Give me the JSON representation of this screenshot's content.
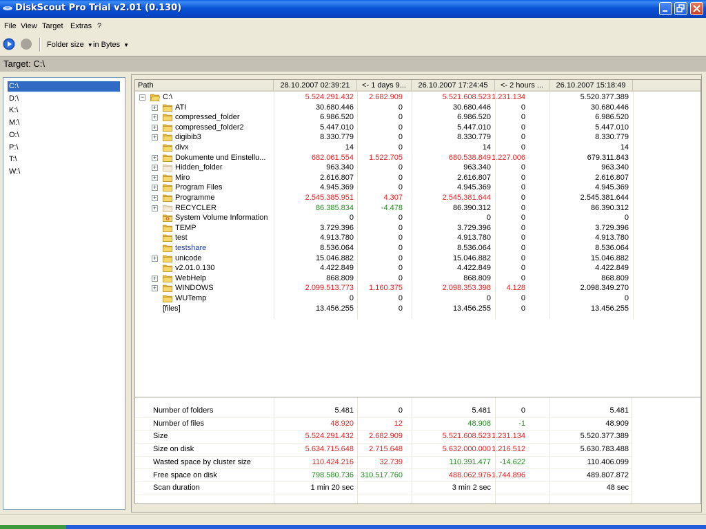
{
  "window": {
    "title": "DiskScout Pro Trial v2.01 (0.130)"
  },
  "menu": [
    "File",
    "View",
    "Target",
    "Extras",
    "?"
  ],
  "toolbar": {
    "mode": "Folder size",
    "unit": "in Bytes"
  },
  "target": {
    "label": "Target: C:\\"
  },
  "drives": [
    "C:\\",
    "D:\\",
    "K:\\",
    "M:\\",
    "O:\\",
    "P:\\",
    "T:\\",
    "W:\\"
  ],
  "selected_drive": "C:\\",
  "columns": [
    "Path",
    "28.10.2007 02:39:21",
    "<- 1 days 9...",
    "26.10.2007 17:24:45",
    "<- 2 hours ...",
    "26.10.2007 15:18:49"
  ],
  "colors": {
    "increase": "#e02020",
    "decrease": "#1e8a1e",
    "shared": "#1d3ba8",
    "selection": "#316ac5"
  },
  "tree": [
    {
      "name": "C:\\",
      "level": 0,
      "expander": "minus",
      "icon": "folder-open-icon",
      "color": "red",
      "values": [
        "5.524.291.432",
        "2.682.909",
        "5.521.608.523",
        "1.231.134",
        "5.520.377.389"
      ]
    },
    {
      "name": "ATI",
      "level": 1,
      "expander": "plus",
      "icon": "folder-icon",
      "color": "",
      "values": [
        "30.680.446",
        "0",
        "30.680.446",
        "0",
        "30.680.446"
      ]
    },
    {
      "name": "compressed_folder",
      "level": 1,
      "expander": "plus",
      "icon": "folder-icon",
      "color": "",
      "values": [
        "6.986.520",
        "0",
        "6.986.520",
        "0",
        "6.986.520"
      ]
    },
    {
      "name": "compressed_folder2",
      "level": 1,
      "expander": "plus",
      "icon": "folder-icon",
      "color": "",
      "values": [
        "5.447.010",
        "0",
        "5.447.010",
        "0",
        "5.447.010"
      ]
    },
    {
      "name": "digibib3",
      "level": 1,
      "expander": "plus",
      "icon": "folder-icon",
      "color": "",
      "values": [
        "8.330.779",
        "0",
        "8.330.779",
        "0",
        "8.330.779"
      ]
    },
    {
      "name": "divx",
      "level": 1,
      "expander": "",
      "icon": "folder-icon",
      "color": "",
      "values": [
        "14",
        "0",
        "14",
        "0",
        "14"
      ]
    },
    {
      "name": "Dokumente und Einstellu...",
      "level": 1,
      "expander": "plus",
      "icon": "folder-icon",
      "color": "red",
      "values": [
        "682.061.554",
        "1.522.705",
        "680.538.849",
        "1.227.006",
        "679.311.843"
      ]
    },
    {
      "name": "Hidden_folder",
      "level": 1,
      "expander": "plus",
      "icon": "folder-hidden-icon",
      "color": "",
      "values": [
        "963.340",
        "0",
        "963.340",
        "0",
        "963.340"
      ]
    },
    {
      "name": "Miro",
      "level": 1,
      "expander": "plus",
      "icon": "folder-icon",
      "color": "",
      "values": [
        "2.616.807",
        "0",
        "2.616.807",
        "0",
        "2.616.807"
      ]
    },
    {
      "name": "Program Files",
      "level": 1,
      "expander": "plus",
      "icon": "folder-icon",
      "color": "",
      "values": [
        "4.945.369",
        "0",
        "4.945.369",
        "0",
        "4.945.369"
      ]
    },
    {
      "name": "Programme",
      "level": 1,
      "expander": "plus",
      "icon": "folder-icon",
      "color": "red",
      "values": [
        "2.545.385.951",
        "4.307",
        "2.545.381.644",
        "0",
        "2.545.381.644"
      ]
    },
    {
      "name": "RECYCLER",
      "level": 1,
      "expander": "plus",
      "icon": "folder-hidden-icon",
      "color": "green",
      "values": [
        "86.385.834",
        "-4.478",
        "86.390.312",
        "0",
        "86.390.312"
      ]
    },
    {
      "name": "System Volume Information",
      "level": 1,
      "expander": "",
      "icon": "folder-locked-icon",
      "color": "",
      "values": [
        "0",
        "0",
        "0",
        "0",
        "0"
      ]
    },
    {
      "name": "TEMP",
      "level": 1,
      "expander": "",
      "icon": "folder-icon",
      "color": "",
      "values": [
        "3.729.396",
        "0",
        "3.729.396",
        "0",
        "3.729.396"
      ]
    },
    {
      "name": "test",
      "level": 1,
      "expander": "",
      "icon": "folder-icon",
      "color": "",
      "values": [
        "4.913.780",
        "0",
        "4.913.780",
        "0",
        "4.913.780"
      ]
    },
    {
      "name": "testshare",
      "level": 1,
      "expander": "",
      "icon": "folder-icon",
      "color": "blue",
      "values": [
        "8.536.064",
        "0",
        "8.536.064",
        "0",
        "8.536.064"
      ]
    },
    {
      "name": "unicode",
      "level": 1,
      "expander": "plus",
      "icon": "folder-icon",
      "color": "",
      "values": [
        "15.046.882",
        "0",
        "15.046.882",
        "0",
        "15.046.882"
      ]
    },
    {
      "name": "v2.01.0.130",
      "level": 1,
      "expander": "",
      "icon": "folder-icon",
      "color": "",
      "values": [
        "4.422.849",
        "0",
        "4.422.849",
        "0",
        "4.422.849"
      ]
    },
    {
      "name": "WebHelp",
      "level": 1,
      "expander": "plus",
      "icon": "folder-icon",
      "color": "",
      "values": [
        "868.809",
        "0",
        "868.809",
        "0",
        "868.809"
      ]
    },
    {
      "name": "WINDOWS",
      "level": 1,
      "expander": "plus",
      "icon": "folder-icon",
      "color": "red",
      "values": [
        "2.099.513.773",
        "1.160.375",
        "2.098.353.398",
        "4.128",
        "2.098.349.270"
      ]
    },
    {
      "name": "WUTemp",
      "level": 1,
      "expander": "",
      "icon": "folder-icon",
      "color": "",
      "values": [
        "0",
        "0",
        "0",
        "0",
        "0"
      ]
    },
    {
      "name": "[files]",
      "level": 1,
      "expander": "",
      "icon": "",
      "color": "",
      "values": [
        "13.456.255",
        "0",
        "13.456.255",
        "0",
        "13.456.255"
      ]
    }
  ],
  "summary": [
    {
      "label": "Number of folders",
      "values": [
        "5.481",
        "0",
        "5.481",
        "0",
        "5.481"
      ],
      "colors": [
        "",
        "",
        "",
        "",
        ""
      ]
    },
    {
      "label": "Number of  files",
      "values": [
        "48.920",
        "12",
        "48.908",
        "-1",
        "48.909"
      ],
      "colors": [
        "red",
        "red",
        "green",
        "green",
        ""
      ]
    },
    {
      "label": "Size",
      "values": [
        "5.524.291.432",
        "2.682.909",
        "5.521.608.523",
        "1.231.134",
        "5.520.377.389"
      ],
      "colors": [
        "red",
        "red",
        "red",
        "red",
        ""
      ]
    },
    {
      "label": "Size on disk",
      "values": [
        "5.634.715.648",
        "2.715.648",
        "5.632.000.000",
        "1.216.512",
        "5.630.783.488"
      ],
      "colors": [
        "red",
        "red",
        "red",
        "red",
        ""
      ]
    },
    {
      "label": "Wasted space by cluster size",
      "values": [
        "110.424.216",
        "32.739",
        "110.391.477",
        "-14.622",
        "110.406.099"
      ],
      "colors": [
        "red",
        "red",
        "green",
        "green",
        ""
      ]
    },
    {
      "label": "Free space on disk",
      "values": [
        "798.580.736",
        "310.517.760",
        "488.062.976",
        "-1.744.896",
        "489.807.872"
      ],
      "colors": [
        "green",
        "green",
        "red",
        "red",
        ""
      ]
    },
    {
      "label": "Scan duration",
      "values": [
        "1 min 20 sec",
        "",
        "3 min 2 sec",
        "",
        "48 sec"
      ],
      "colors": [
        "",
        "",
        "",
        "",
        ""
      ]
    }
  ]
}
